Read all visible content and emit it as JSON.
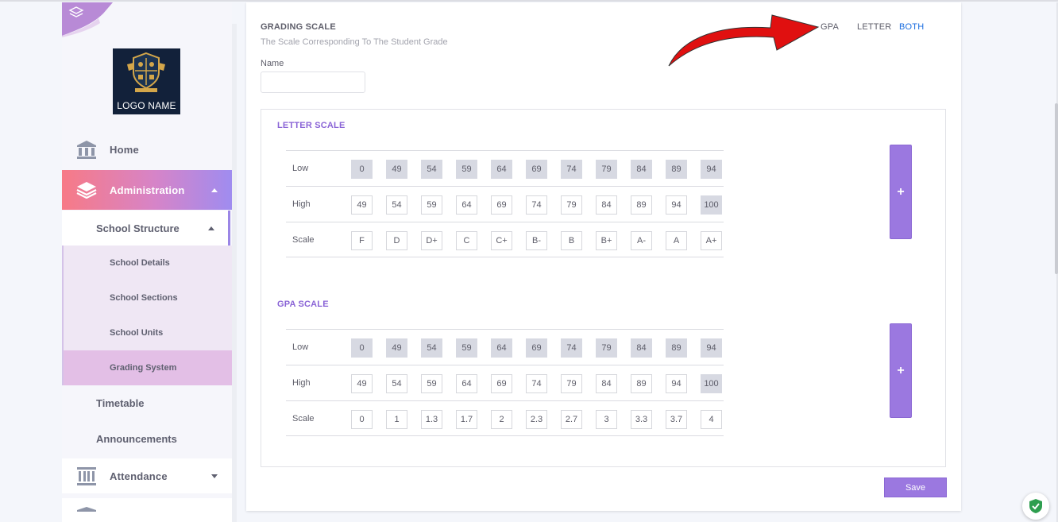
{
  "sidebar": {
    "logo_text": "LOGO NAME",
    "items": {
      "home": "Home",
      "administration": "Administration",
      "school_structure": "School Structure",
      "school_details": "School Details",
      "school_sections": "School Sections",
      "school_units": "School Units",
      "grading_system": "Grading System",
      "timetable": "Timetable",
      "announcements": "Announcements",
      "attendance": "Attendance"
    },
    "icons": {
      "home": "bank-icon",
      "administration": "layers-icon",
      "attendance": "columns-icon"
    }
  },
  "main": {
    "title": "GRADING SCALE",
    "subtitle": "The Scale Corresponding To The Student Grade",
    "name_label": "Name",
    "name_value": "",
    "options": {
      "gpa": "GPA",
      "letter": "LETTER",
      "both": "BOTH",
      "selected": "both"
    },
    "letter_scale": {
      "title": "LETTER SCALE",
      "labels": {
        "low": "Low",
        "high": "High",
        "scale": "Scale"
      },
      "low": [
        "0",
        "49",
        "54",
        "59",
        "64",
        "69",
        "74",
        "79",
        "84",
        "89",
        "94"
      ],
      "high": [
        "49",
        "54",
        "59",
        "64",
        "69",
        "74",
        "79",
        "84",
        "89",
        "94",
        "100"
      ],
      "scale": [
        "F",
        "D",
        "D+",
        "C",
        "C+",
        "B-",
        "B",
        "B+",
        "A-",
        "A",
        "A+"
      ]
    },
    "gpa_scale": {
      "title": "GPA SCALE",
      "labels": {
        "low": "Low",
        "high": "High",
        "scale": "Scale"
      },
      "low": [
        "0",
        "49",
        "54",
        "59",
        "64",
        "69",
        "74",
        "79",
        "84",
        "89",
        "94"
      ],
      "high": [
        "49",
        "54",
        "59",
        "64",
        "69",
        "74",
        "79",
        "84",
        "89",
        "94",
        "100"
      ],
      "scale": [
        "0",
        "1",
        "1.3",
        "1.7",
        "2",
        "2.3",
        "2.7",
        "3",
        "3.3",
        "3.7",
        "4"
      ]
    },
    "add_label": "+",
    "save_label": "Save"
  },
  "colors": {
    "accent": "#9b78e0",
    "admin_gradient_start": "#f77a86",
    "admin_gradient_end": "#9f8cf0",
    "link_selected": "#1c6ee0",
    "arrow": "#e01010"
  }
}
